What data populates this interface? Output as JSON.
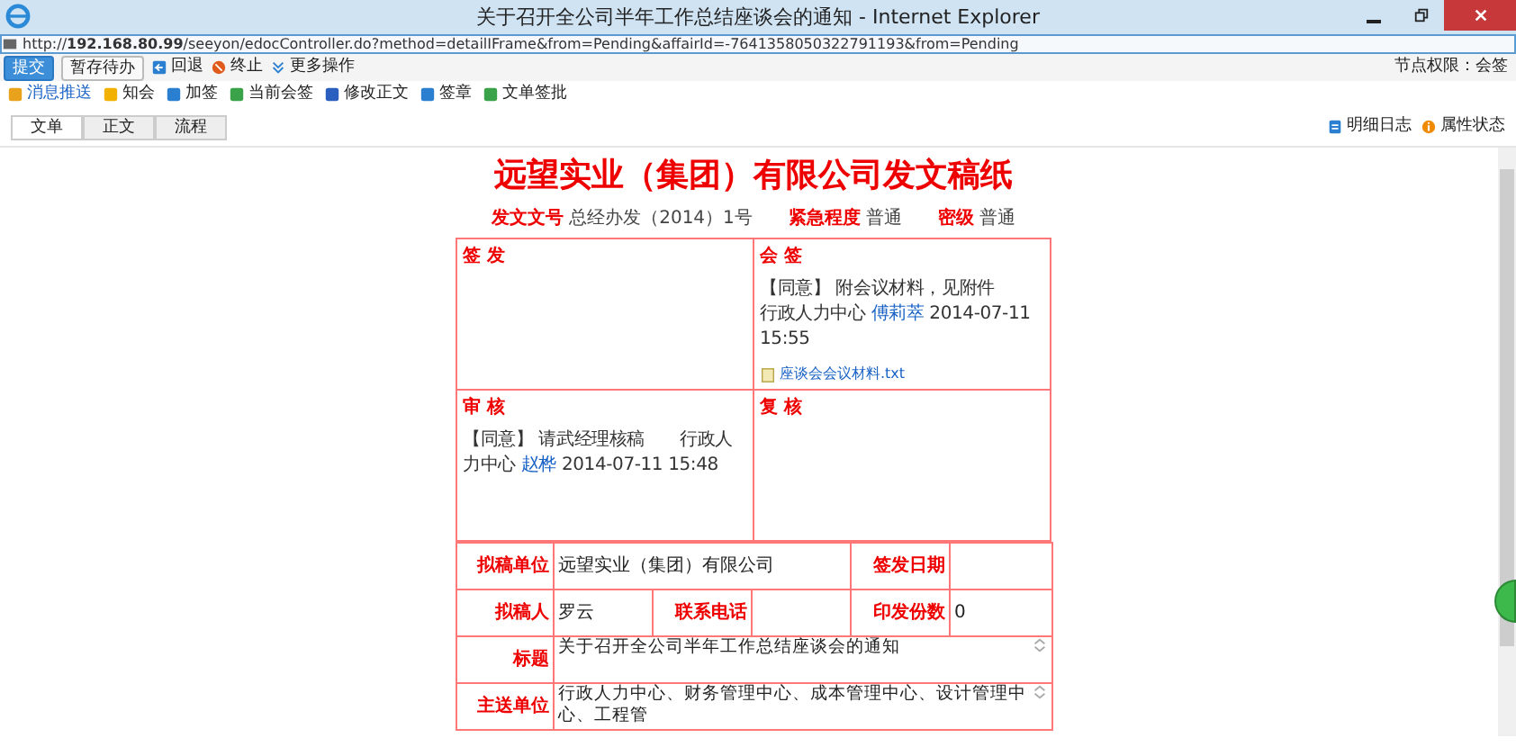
{
  "window": {
    "title": "关于召开全公司半年工作总结座谈会的通知 - Internet Explorer"
  },
  "address_bar": {
    "url": "http://**192.168.80.99**/seeyon/edocController.do?method=detailIFrame&from=Pending&affairId=-7641358050322791193&from=Pending"
  },
  "toolbar": {
    "buttons": [
      {
        "label": "提交",
        "kind": "primary"
      },
      {
        "label": "暂存待办",
        "kind": "plain"
      },
      {
        "label": "回退",
        "kind": "back"
      },
      {
        "label": "终止",
        "kind": "stop"
      },
      {
        "label": "更多操作",
        "kind": "more"
      }
    ],
    "node_permission": "节点权限：会签"
  },
  "action_bar": [
    {
      "label": "消息推送",
      "highlighted": true
    },
    {
      "label": "知会",
      "highlighted": false
    },
    {
      "label": "加签",
      "highlighted": false
    },
    {
      "label": "当前会签",
      "highlighted": false
    },
    {
      "label": "修改正文",
      "highlighted": false
    },
    {
      "label": "签章",
      "highlighted": false
    },
    {
      "label": "文单签批",
      "highlighted": false
    }
  ],
  "tabs": [
    {
      "label": "文单",
      "selected": true
    },
    {
      "label": "正文",
      "selected": false
    },
    {
      "label": "流程",
      "selected": false
    }
  ],
  "side_links": [
    {
      "label": "明细日志"
    },
    {
      "label": "属性状态"
    }
  ],
  "document": {
    "title": "远望实业（集团）有限公司发文稿纸",
    "meta": [
      {
        "label": "发文文号",
        "value": "总经办发（2014）1号"
      },
      {
        "label": "紧急程度",
        "value": "普通"
      },
      {
        "label": "密级",
        "value": "普通"
      }
    ],
    "boxes": [
      {
        "heading": "签 发"
      },
      {
        "heading": "会 签",
        "opinions": [
          {
            "stance": "【同意】",
            "text": "附会议材料，见附件",
            "dept": "行政人力中心",
            "signer": "傅莉萃",
            "time": "2014-07-11 15:55"
          }
        ],
        "attachment": "座谈会会议材料.txt"
      },
      {
        "heading": "审 核",
        "opinions": [
          {
            "stance": "【同意】",
            "text": "请武经理核稿",
            "dept": "行政人力中心",
            "signer": "赵桦",
            "time": "2014-07-11 15:48"
          }
        ]
      },
      {
        "heading": "复 核"
      }
    ],
    "form": [
      [
        {
          "kind": "label",
          "text": "拟稿单位"
        },
        {
          "kind": "value",
          "text": "远望实业（集团）有限公司"
        },
        {
          "kind": "label",
          "text": "签发日期"
        },
        {
          "kind": "value"
        }
      ],
      [
        {
          "kind": "label",
          "text": "拟稿人"
        },
        {
          "kind": "value",
          "text": "罗云"
        },
        {
          "kind": "label",
          "text": "联系电话"
        },
        {
          "kind": "value"
        },
        {
          "kind": "label",
          "text": "印发份数"
        },
        {
          "kind": "value",
          "text": "0"
        }
      ],
      [
        {
          "kind": "label",
          "text": "标题"
        },
        {
          "kind": "textarea",
          "text": "关于召开全公司半年工作总结座谈会的通知"
        }
      ],
      [
        {
          "kind": "label",
          "text": "主送单位"
        },
        {
          "kind": "textarea",
          "text": "行政人力中心、财务管理中心、成本管理中心、设计管理中心、工程管"
        }
      ]
    ]
  }
}
